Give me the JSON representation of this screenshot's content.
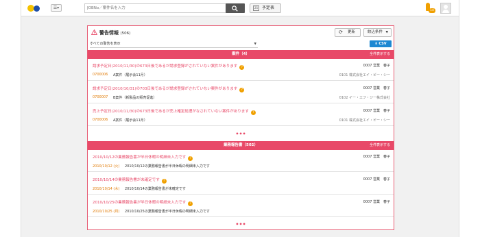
{
  "search": {
    "placeholder": "JOBNo／案件名を入力"
  },
  "header": {
    "schedule_label": "予定表",
    "calendar_day": "25",
    "notification_count": "14"
  },
  "panel": {
    "title": "警告情報",
    "count": "(506)",
    "refresh_label": "更新",
    "filter_label": "絞込条件",
    "filter_select": "すべての警告を表示",
    "csv_label": "CSV"
  },
  "sections": [
    {
      "title": "案件（4）",
      "show_all": "全件表示する",
      "rows": [
        {
          "message": "請求予定日(2010/11/30)の673日後であるが請求登録がされていない案件があります",
          "user": "0007 営業　春子",
          "code": "0700006",
          "name": "A案件（展示会11月）",
          "company": "0101 株式会社エイ・ビー・シー"
        },
        {
          "message": "請求予定日(2010/10/31)の703日後であるが請求登録がされていない案件があります",
          "user": "0007 営業　春子",
          "code": "0700007",
          "name": "B案件（新製品の販売促進）",
          "company": "0102 イー・エフ・ジー株式会社"
        },
        {
          "message": "売上予定日(2010/11/30)の673日後であるが売上確定処理がなされていない案件があります",
          "user": "0007 営業　春子",
          "code": "0700006",
          "name": "A案件（展示会11月）",
          "company": "0101 株式会社エイ・ビー・シー"
        }
      ]
    },
    {
      "title": "業務報告書（502）",
      "show_all": "全件表示する",
      "rows": [
        {
          "message": "2010/10/12の業務報告書が半日休暇の明細未入力です",
          "user": "0007 営業　春子",
          "date": "2010/10/12 (火)",
          "detail": "2010/10/12の業務報告書が半日休暇の明細未入力です"
        },
        {
          "message": "2010/10/14の業務報告書が未確定です",
          "user": "0007 営業　春子",
          "date": "2010/10/14 (木)",
          "detail": "2010/10/14の業務報告書が未確定です"
        },
        {
          "message": "2010/10/25の業務報告書が半日休暇の明細未入力です",
          "user": "0007 営業　春子",
          "date": "2010/10/25 (月)",
          "detail": "2010/10/25の業務報告書が半日休暇の明細未入力です"
        }
      ]
    }
  ],
  "more_indicator": "•••",
  "colors": {
    "accent": "#e84968",
    "link_orange": "#e07800",
    "csv_blue": "#1e88d2"
  }
}
